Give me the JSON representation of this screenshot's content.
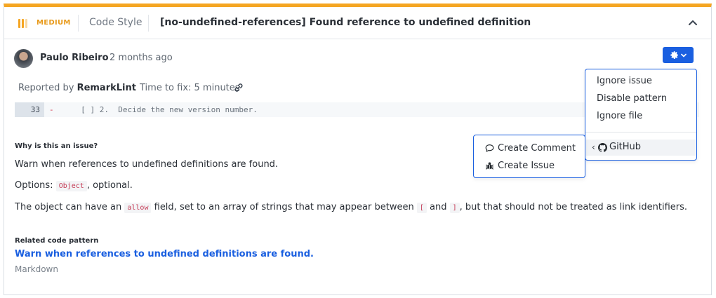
{
  "issue": {
    "severity": "MEDIUM",
    "category": "Code Style",
    "title": "[no-undefined-references] Found reference to undefined definition",
    "accent_color": "#f5a623"
  },
  "author": {
    "name": "Paulo Ribeiro",
    "time_ago": "2 months ago"
  },
  "meta": {
    "reported_prefix": "Reported by",
    "reporter": "RemarkLint",
    "time_to_fix": "Time to fix: 5 minutes"
  },
  "code": {
    "line_number": "33",
    "marker": "-",
    "text": "  [ ] 2.  Decide the new version number."
  },
  "explanation": {
    "heading": "Why is this an issue?",
    "summary": "Warn when references to undefined definitions are found.",
    "options_label": "Options:",
    "options_code": "Object",
    "options_suffix": ", optional.",
    "p3_a": "The object can have an",
    "p3_code1": "allow",
    "p3_b": "field, set to an array of strings that may appear between",
    "p3_code2": "[",
    "p3_c": "and",
    "p3_code3": "]",
    "p3_d": ", but that should not be treated as link identifiers."
  },
  "related": {
    "heading": "Related code pattern",
    "pattern": "Warn when references to undefined definitions are found.",
    "language": "Markdown"
  },
  "menu": {
    "items": [
      "Ignore issue",
      "Disable pattern",
      "Ignore file"
    ],
    "github_label": "GitHub"
  },
  "submenu": {
    "create_comment": "Create Comment",
    "create_issue": "Create Issue"
  },
  "icons": {
    "severity": "severity-bars-icon",
    "collapse": "chevron-up-icon",
    "settings": "gear-icon",
    "link": "link-icon",
    "github": "github-icon",
    "comment": "comment-icon",
    "bug": "bug-icon"
  },
  "colors": {
    "primary": "#1a5fe0",
    "medium": "#f5a623",
    "code_red": "#c53b55"
  }
}
